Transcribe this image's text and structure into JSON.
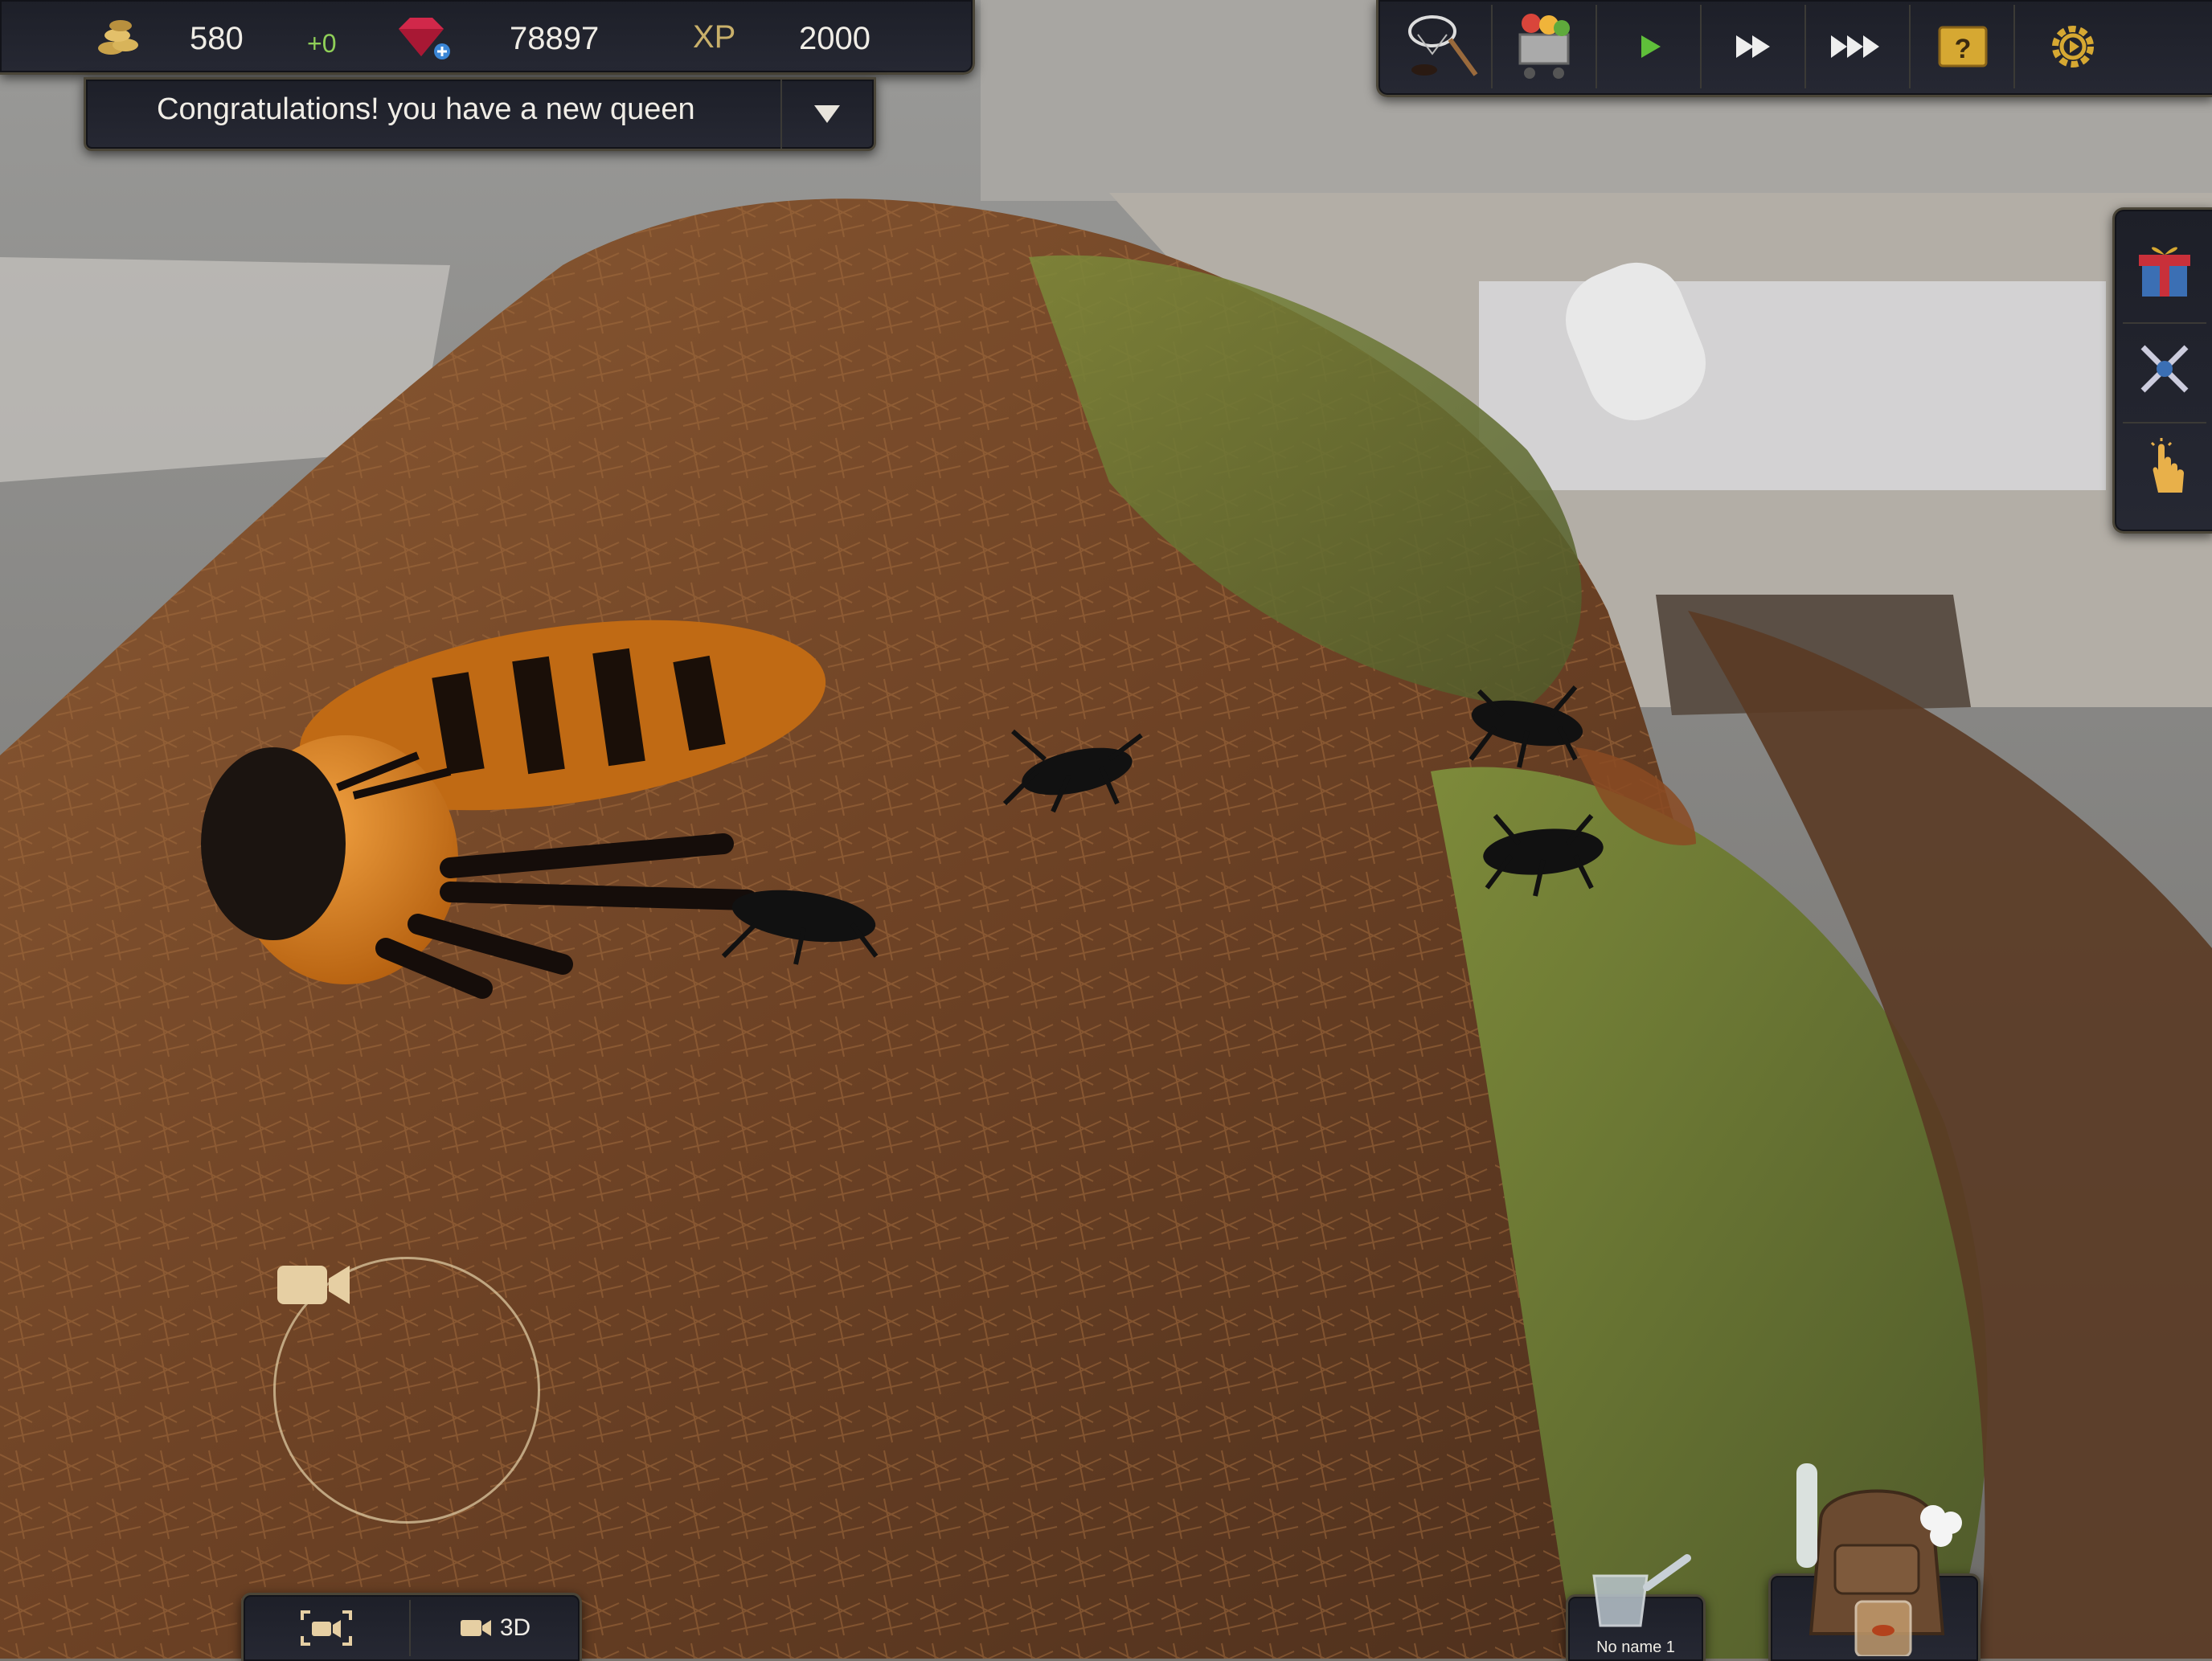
{
  "hud": {
    "coins": "580",
    "coins_delta": "+0",
    "gems": "78897",
    "xp_label": "XP",
    "xp": "2000"
  },
  "notification": {
    "message": "Congratulations! you have a new queen"
  },
  "toolbar": {
    "icons": [
      "net-icon",
      "shop-cart-icon",
      "play-icon",
      "fast-forward-icon",
      "fastest-forward-icon",
      "help-book-icon",
      "settings-gear-icon"
    ]
  },
  "sidebar": {
    "icons": [
      "gift-icon",
      "crossed-swords-icon",
      "tap-hand-icon"
    ]
  },
  "camera_toggle": {
    "mode_3d_label": "3D"
  },
  "inventory": {
    "item_label": "No name 1"
  },
  "colors": {
    "panel_bg": "#1f212b",
    "panel_border": "#4a4538",
    "accent_gold": "#c9b06a",
    "delta_green": "#8fcf58",
    "play_green": "#5fbf3a"
  }
}
